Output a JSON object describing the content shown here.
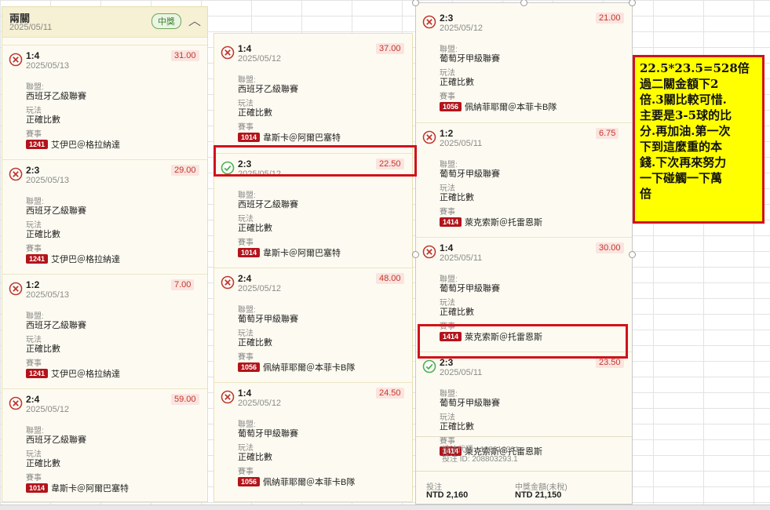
{
  "parlay": {
    "title": "兩關",
    "date": "2025/05/11",
    "badge": "中獎"
  },
  "labels": {
    "league": "聯盟:",
    "play": "玩法",
    "match": "賽事"
  },
  "columns": [
    [
      {
        "score": "1:4",
        "date": "2025/05/13",
        "odds": "31.00",
        "league": "西班牙乙級聯賽",
        "play": "正確比數",
        "code": "1241",
        "match": "艾伊巴＠格拉納達",
        "status": "lost"
      },
      {
        "score": "2:3",
        "date": "2025/05/13",
        "odds": "29.00",
        "league": "西班牙乙級聯賽",
        "play": "正確比數",
        "code": "1241",
        "match": "艾伊巴＠格拉納達",
        "status": "lost"
      },
      {
        "score": "1:2",
        "date": "2025/05/13",
        "odds": "7.00",
        "league": "西班牙乙級聯賽",
        "play": "正確比數",
        "code": "1241",
        "match": "艾伊巴＠格拉納達",
        "status": "lost"
      },
      {
        "score": "2:4",
        "date": "2025/05/12",
        "odds": "59.00",
        "league": "西班牙乙級聯賽",
        "play": "正確比數",
        "code": "1014",
        "match": "韋斯卡＠阿爾巴塞特",
        "status": "lost"
      }
    ],
    [
      {
        "score": "1:4",
        "date": "2025/05/12",
        "odds": "37.00",
        "league": "西班牙乙級聯賽",
        "play": "正確比數",
        "code": "1014",
        "match": "韋斯卡＠阿爾巴塞特",
        "status": "lost"
      },
      {
        "score": "2:3",
        "date": "2025/05/12",
        "odds": "22.50",
        "league": "西班牙乙級聯賽",
        "play": "正確比數",
        "code": "1014",
        "match": "韋斯卡＠阿爾巴塞特",
        "status": "won"
      },
      {
        "score": "2:4",
        "date": "2025/05/12",
        "odds": "48.00",
        "league": "葡萄牙甲級聯賽",
        "play": "正確比數",
        "code": "1056",
        "match": "佩納菲耶爾＠本菲卡B隊",
        "status": "lost"
      },
      {
        "score": "1:4",
        "date": "2025/05/12",
        "odds": "24.50",
        "league": "葡萄牙甲級聯賽",
        "play": "正確比數",
        "code": "1056",
        "match": "佩納菲耶爾＠本菲卡B隊",
        "status": "lost"
      }
    ],
    [
      {
        "score": "2:3",
        "date": "2025/05/12",
        "odds": "21.00",
        "league": "葡萄牙甲級聯賽",
        "play": "正確比數",
        "code": "1056",
        "match": "佩納菲耶爾＠本菲卡B隊",
        "status": "lost"
      },
      {
        "score": "1:2",
        "date": "2025/05/11",
        "odds": "6.75",
        "league": "葡萄牙甲級聯賽",
        "play": "正確比數",
        "code": "1414",
        "match": "萊克索斯＠托雷恩斯",
        "status": "lost"
      },
      {
        "score": "1:4",
        "date": "2025/05/11",
        "odds": "30.00",
        "league": "葡萄牙甲級聯賽",
        "play": "正確比數",
        "code": "1414",
        "match": "萊克索斯＠托雷恩斯",
        "status": "lost"
      },
      {
        "score": "2:3",
        "date": "2025/05/11",
        "odds": "23.50",
        "league": "葡萄牙甲級聯賽",
        "play": "正確比數",
        "code": "1414",
        "match": "萊克索斯＠托雷恩斯",
        "status": "won"
      }
    ]
  ],
  "footer": {
    "bet_code": "投注代碼:: 183916001",
    "bet_id": "投注 ID: 208803293.1",
    "stake_label": "投注",
    "stake_value": "NTD 2,160",
    "payout_label": "中獎金額(未稅)",
    "payout_value": "NTD 21,150"
  },
  "note": {
    "lines": [
      "22.5*23.5=528倍",
      "過二關金額下2",
      "倍.3關比較可惜.",
      "主要是3-5球的比",
      "分.再加油.第一次",
      "下到這麼重的本",
      "錢.下次再來努力",
      "一下碰觸一下萬",
      "倍"
    ]
  },
  "colors": {
    "lost": "#c0392b",
    "won": "#4caf50",
    "highlight": "#d0121b",
    "note_bg": "#ffff00"
  }
}
